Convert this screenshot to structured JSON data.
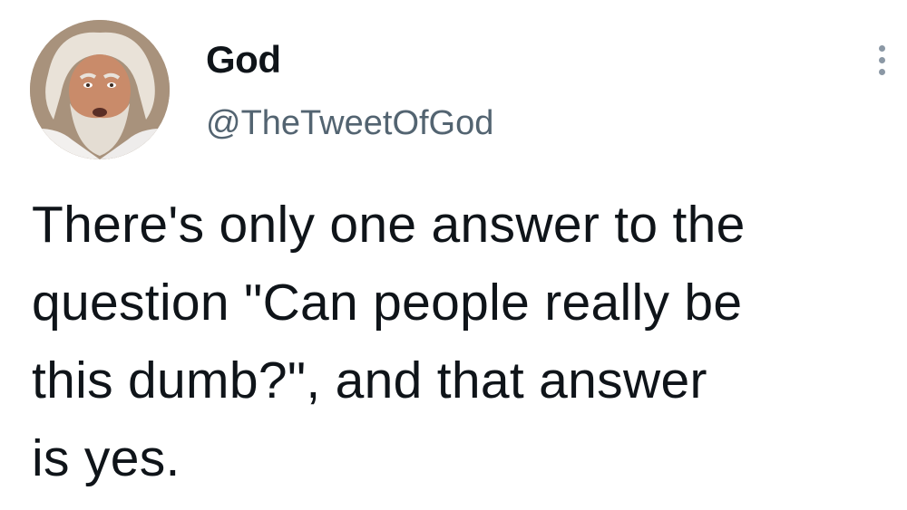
{
  "author": {
    "display_name": "God",
    "handle": "@TheTweetOfGod",
    "avatar_icon": "avatar-photo-icon"
  },
  "more_menu_icon": "more-options-icon",
  "tweet": {
    "lines": [
      "There's only one answer to the",
      "question \"Can people really be",
      "this dumb?\", and that answer",
      "is yes."
    ]
  },
  "colors": {
    "text_primary": "#0f1419",
    "text_secondary": "#536471",
    "background": "#ffffff"
  }
}
